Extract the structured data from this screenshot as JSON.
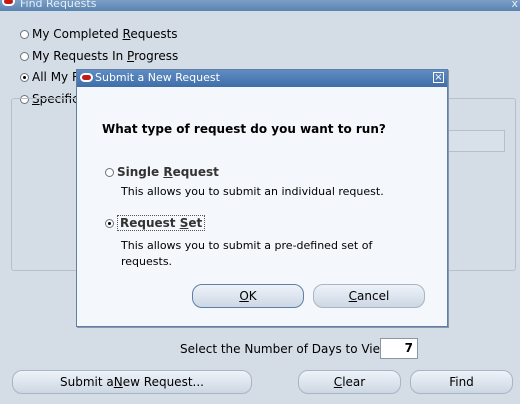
{
  "back_window": {
    "title": "Find Requests",
    "close_glyph": "x",
    "radio_options": [
      {
        "label_pre": "My Completed ",
        "label_u": "R",
        "label_post": "equests",
        "selected": false
      },
      {
        "label_pre": "My Requests In ",
        "label_u": "P",
        "label_post": "rogress",
        "selected": false
      },
      {
        "label_pre": "All My R",
        "label_u": "",
        "label_post": "",
        "selected": true
      },
      {
        "label_pre": "",
        "label_u": "S",
        "label_post": "pecific",
        "selected": false
      }
    ],
    "days_label": "Select the Number of Days to View:",
    "days_value": "7",
    "buttons": {
      "submit_pre": "Submit a ",
      "submit_u": "N",
      "submit_post": "ew Request...",
      "clear_u": "C",
      "clear_post": "lear",
      "find": "Find"
    }
  },
  "dialog": {
    "title": "Submit a New Request",
    "close_glyph": "×",
    "question": "What type of request do you want to run?",
    "options": [
      {
        "label_pre": "Single ",
        "label_u": "R",
        "label_post": "equest",
        "description": "This allows you to submit an individual request.",
        "selected": false
      },
      {
        "label_pre": "Request ",
        "label_u": "S",
        "label_post": "et",
        "description_line1": "This allows you to submit a pre-defined set of",
        "description_line2": "requests.",
        "selected": true
      }
    ],
    "ok_u": "O",
    "ok_post": "K",
    "cancel_u": "C",
    "cancel_post": "ancel"
  },
  "colors": {
    "accent": "#3f6ea8",
    "oracle_red": "#c21b17",
    "background": "#d4dce6"
  },
  "icons": [
    "oracle-logo-icon",
    "close-icon",
    "radio-icon"
  ]
}
